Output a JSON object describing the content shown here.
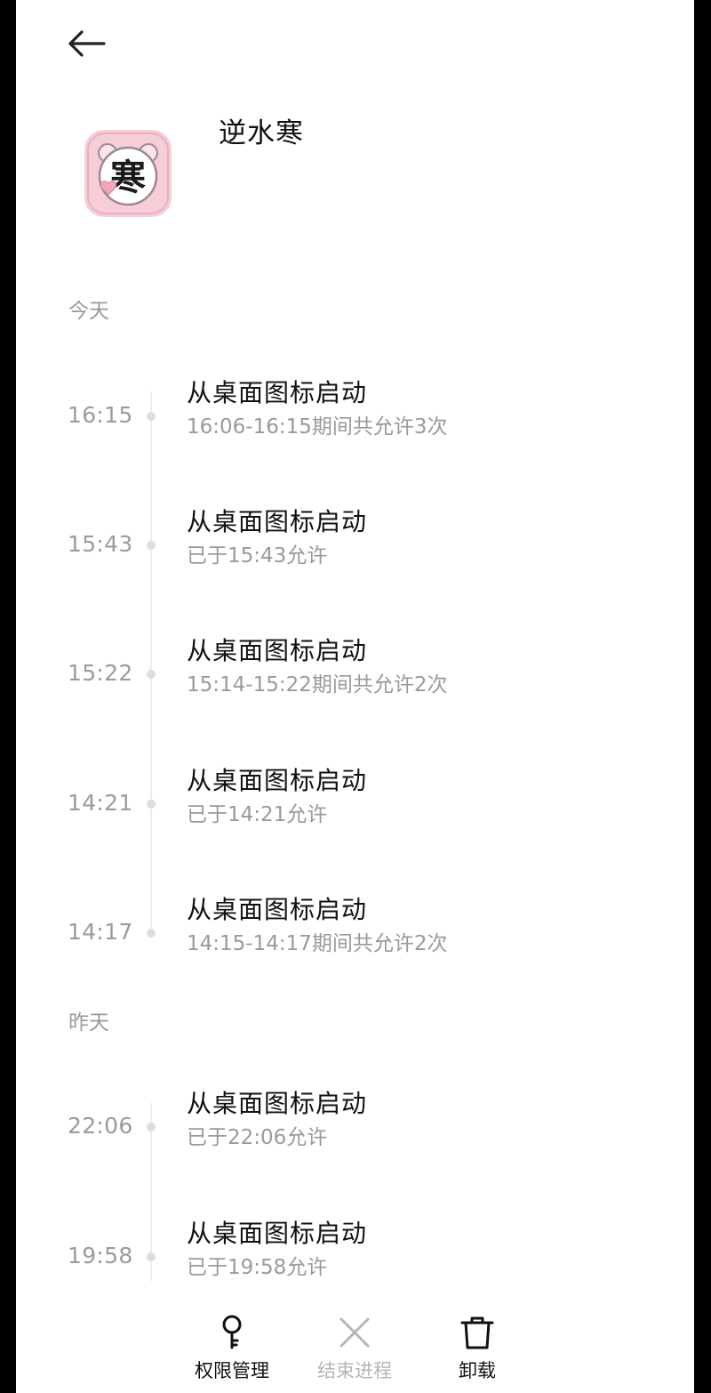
{
  "app": {
    "name": "逆水寒",
    "icon_char": "寒"
  },
  "sections": [
    {
      "header": "今天",
      "entries": [
        {
          "time": "16:15",
          "title": "从桌面图标启动",
          "detail": "16:06-16:15期间共允许3次"
        },
        {
          "time": "15:43",
          "title": "从桌面图标启动",
          "detail": "已于15:43允许"
        },
        {
          "time": "15:22",
          "title": "从桌面图标启动",
          "detail": "15:14-15:22期间共允许2次"
        },
        {
          "time": "14:21",
          "title": "从桌面图标启动",
          "detail": "已于14:21允许"
        },
        {
          "time": "14:17",
          "title": "从桌面图标启动",
          "detail": "14:15-14:17期间共允许2次"
        }
      ]
    },
    {
      "header": "昨天",
      "entries": [
        {
          "time": "22:06",
          "title": "从桌面图标启动",
          "detail": "已于22:06允许"
        },
        {
          "time": "19:58",
          "title": "从桌面图标启动",
          "detail": "已于19:58允许"
        }
      ]
    }
  ],
  "bottom_bar": {
    "permissions": {
      "label": "权限管理",
      "icon": "key-icon"
    },
    "end_process": {
      "label": "结束进程",
      "icon": "close-x-icon",
      "disabled": true
    },
    "uninstall": {
      "label": "卸载",
      "icon": "trash-icon"
    }
  },
  "colors": {
    "text_primary": "#111111",
    "text_secondary": "#9a9a9a",
    "disabled": "#b5b5b5",
    "icon_bg": "#f6c6d2"
  }
}
